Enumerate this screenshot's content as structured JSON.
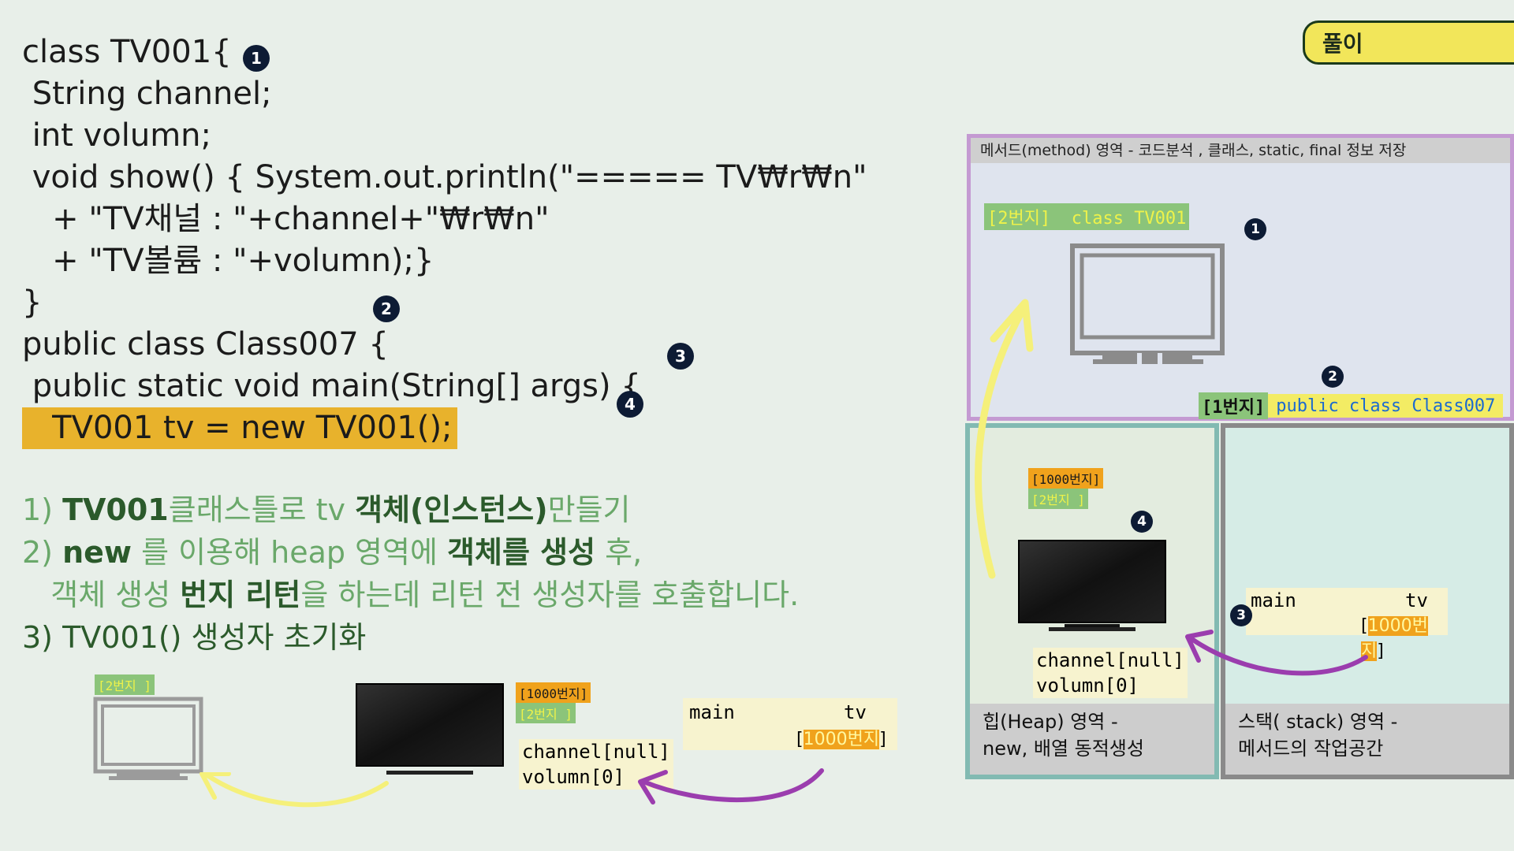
{
  "code": {
    "lines": [
      "class TV001{",
      " String channel;",
      " int volumn;",
      " void show() { System.out.println(\"===== TV₩r₩n\"",
      "   + \"TV채널 : \"+channel+\"₩r₩n\"",
      "   + \"TV볼륨 : \"+volumn);}",
      "}",
      "public class Class007 {",
      " public static void main(String[] args) {",
      "   TV001 tv = new TV001();"
    ]
  },
  "markers": [
    "1",
    "2",
    "3",
    "4"
  ],
  "notes": {
    "n1_prefix": "1) ",
    "n1_a": "TV001",
    "n1_b": "클래스틀로 tv ",
    "n1_c": "객체(인스턴스)",
    "n1_d": "만들기",
    "n2_prefix": "2) ",
    "n2_a": "new",
    "n2_b": " 를 이용해 heap 영역에 ",
    "n2_c": "객체를 생성",
    "n2_d": " 후,",
    "n2l2_a": "   객체 생성 ",
    "n2l2_b": "번지 리턴",
    "n2l2_c": "을 하는데 리턴 전 생성자를 호출합니다.",
    "n3": "3) TV001() 생성자 초기화"
  },
  "badge": "풀이",
  "method_area": {
    "title": "메서드(method) 영역  - 코드분석 , 클래스, static, final 정보 저장",
    "class_tag_addr": "[2번지]",
    "class_tag_label": "class  TV001",
    "main_tag_addr": "[1번지]",
    "main_tag_label": "public class   Class007"
  },
  "heap_area": {
    "addr1": "[1000번지]",
    "addr2": "[2번지   ]",
    "field1": "channel[null]",
    "field2": "volumn[0]",
    "caption_l1": "힙(Heap) 영역 -",
    "caption_l2": " new, 배열 동적생성"
  },
  "stack_area": {
    "var_scope": "main",
    "var_name": "tv",
    "var_value": "1000번지",
    "caption_l1": "스택( stack) 영역 -",
    "caption_l2": "메서드의 작업공간"
  },
  "bottom": {
    "class_addr": "[2번지    ]",
    "obj_addr1": "[1000번지]",
    "obj_addr2": "[2번지    ]",
    "field1": "channel[null]",
    "field2": "volumn[0]",
    "var_scope": "main",
    "var_name": "tv",
    "var_value": "1000번지"
  },
  "colors": {
    "background": "#e8efe9",
    "highlight": "#e8b22c",
    "note_light": "#6aa86a",
    "note_dark": "#2b5a2b",
    "badge": "#f2e65a",
    "method_border": "#c49ad2",
    "heap_border": "#82bab2",
    "stack_border": "#8a8a8a",
    "arrow_yellow": "#f5f07a",
    "arrow_purple": "#9b3dae",
    "tag_green": "#8bc47a",
    "tag_orange": "#f0a21c"
  }
}
